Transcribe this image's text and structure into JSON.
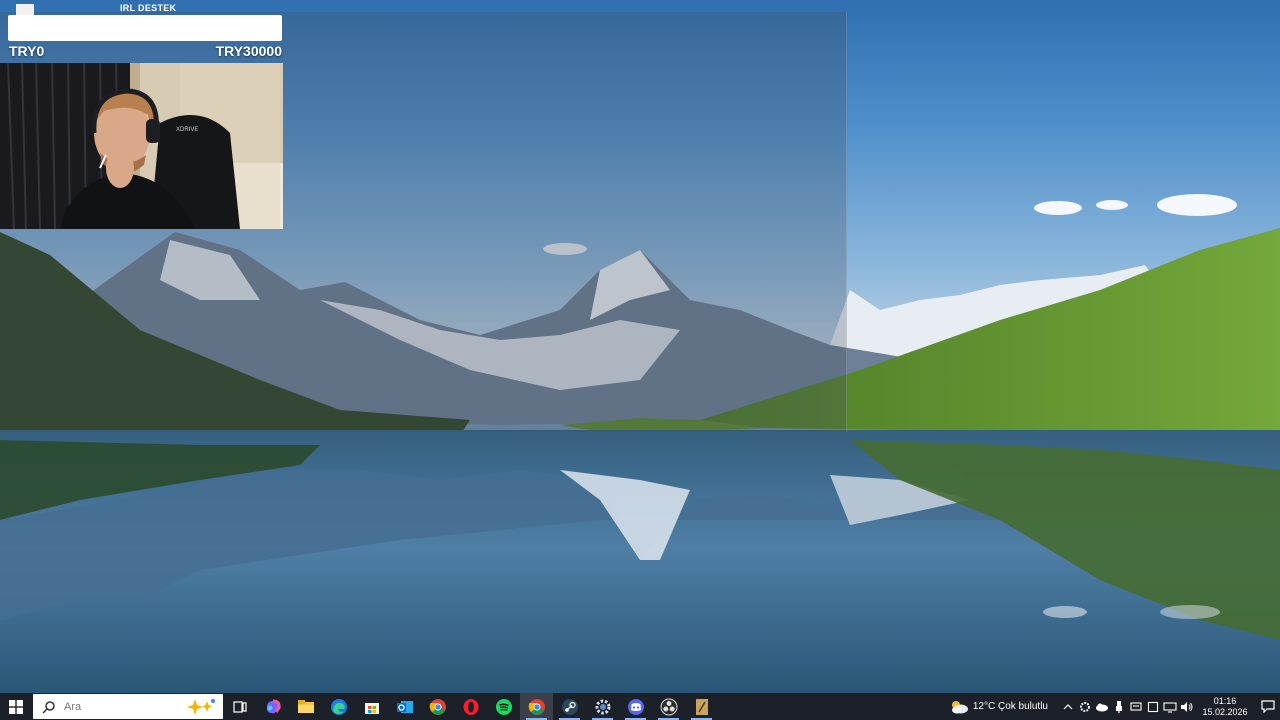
{
  "overlay": {
    "donation_title": "IRL DESTEK",
    "goal_current": "TRY0",
    "goal_target": "TRY30000",
    "goal_progress": 0
  },
  "taskbar": {
    "search_placeholder": "Ara",
    "apps": [
      {
        "name": "task-view-icon",
        "active": false
      },
      {
        "name": "copilot-icon",
        "active": false
      },
      {
        "name": "file-explorer-icon",
        "active": false
      },
      {
        "name": "edge-icon",
        "active": false
      },
      {
        "name": "store-icon",
        "active": false
      },
      {
        "name": "outlook-icon",
        "active": false
      },
      {
        "name": "chrome-icon",
        "active": false
      },
      {
        "name": "opera-icon",
        "active": false
      },
      {
        "name": "spotify-icon",
        "active": false
      },
      {
        "name": "chrome-icon",
        "active": true
      },
      {
        "name": "steam-icon",
        "active": false
      },
      {
        "name": "gear-icon",
        "active": false
      },
      {
        "name": "discord-icon",
        "active": false
      },
      {
        "name": "obs-icon",
        "active": false
      },
      {
        "name": "app-icon",
        "active": false
      }
    ],
    "weather": {
      "temp": "12°C",
      "condition": "Çok bulutlu"
    },
    "clock": {
      "time": "01:16",
      "date": "15.02.2026"
    }
  },
  "colors": {
    "taskbar": "#1c2028",
    "accent": "#8ab4f8"
  }
}
